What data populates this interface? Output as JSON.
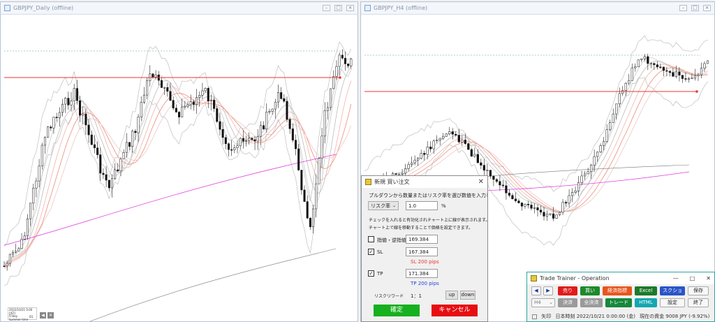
{
  "left_chart": {
    "title": "GBPJPY_Daily (offline)",
    "info_box": [
      "2022/10/21 0:00 (JST)",
      "Friday",
      "Summer time",
      "D1"
    ]
  },
  "right_chart": {
    "title": "GBPJPY_H4 (offline)"
  },
  "order_dialog": {
    "title": "新規 買い注文",
    "instruction": "プルダウンから数量またはリスク率を選び数値を入力してください。",
    "risk_mode": "リスク率",
    "risk_value": "1.0",
    "risk_unit": "%",
    "hint_line1": "チェックを入れると有効化されチャート上に線が表示されます。",
    "hint_line2": "チャート上で線を移動することで価格を設定できます。",
    "limit_label": "指値・逆指値",
    "limit_value": "169.384",
    "sl_label": "SL",
    "sl_value": "167.384",
    "sl_pips": "SL 200 pips",
    "tp_label": "TP",
    "tp_value": "171.384",
    "tp_pips": "TP 200 pips",
    "rr_label": "リスクリワード",
    "rr_value": "1：1",
    "up_label": "up",
    "down_label": "down",
    "confirm_label": "確定",
    "cancel_label": "キャンセル",
    "colors": {
      "confirm": "#17b01e",
      "cancel": "#e60e12",
      "sl": "#e33",
      "tp": "#2244dd"
    }
  },
  "trainer": {
    "title": "Trade Trainer - Operation",
    "prev_icon": "◀",
    "next_icon": "▶",
    "sell": "売り",
    "buy": "買い",
    "exit_instruction": "経済指標",
    "excel": "Excel",
    "screenshot": "スクショ",
    "save": "保存",
    "timeframe": "H4",
    "settle": "決済",
    "settle_all": "全決済",
    "trade": "トレード",
    "html": "HTML",
    "settings": "設定",
    "quit": "終了",
    "arrow_label": "矢印",
    "time_label": "日本時刻 2022/10/21 0:00:00 (金)",
    "balance_label": "現在の資金 9008 JPY (-9.92%)"
  }
}
